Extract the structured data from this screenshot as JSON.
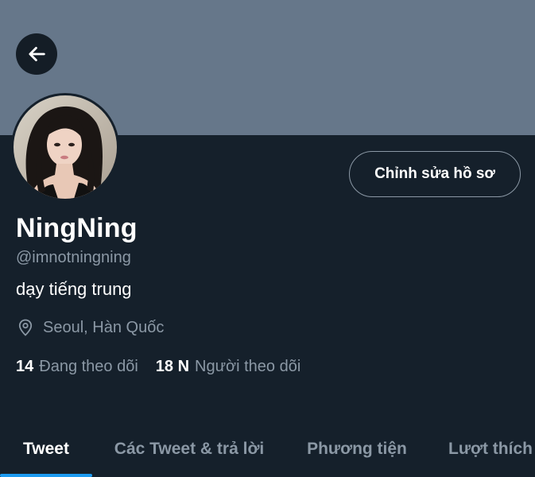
{
  "profile": {
    "display_name": "NingNing",
    "handle": "@imnotningning",
    "bio": "dạy tiếng trung",
    "location": "Seoul, Hàn Quốc",
    "following_count": "14",
    "following_label": "Đang theo dõi",
    "followers_count": "18 N",
    "followers_label": "Người theo dõi"
  },
  "actions": {
    "edit_profile_label": "Chỉnh sửa hồ sơ"
  },
  "tabs": [
    {
      "label": "Tweet",
      "active": true
    },
    {
      "label": "Các Tweet & trả lời",
      "active": false
    },
    {
      "label": "Phương tiện",
      "active": false
    },
    {
      "label": "Lượt thích",
      "active": false
    }
  ],
  "icons": {
    "back": "arrow-left-icon",
    "location": "location-pin-icon"
  },
  "colors": {
    "background": "#15202b",
    "banner": "#66778a",
    "accent": "#1d9bf0",
    "secondary_text": "#8b98a5"
  }
}
